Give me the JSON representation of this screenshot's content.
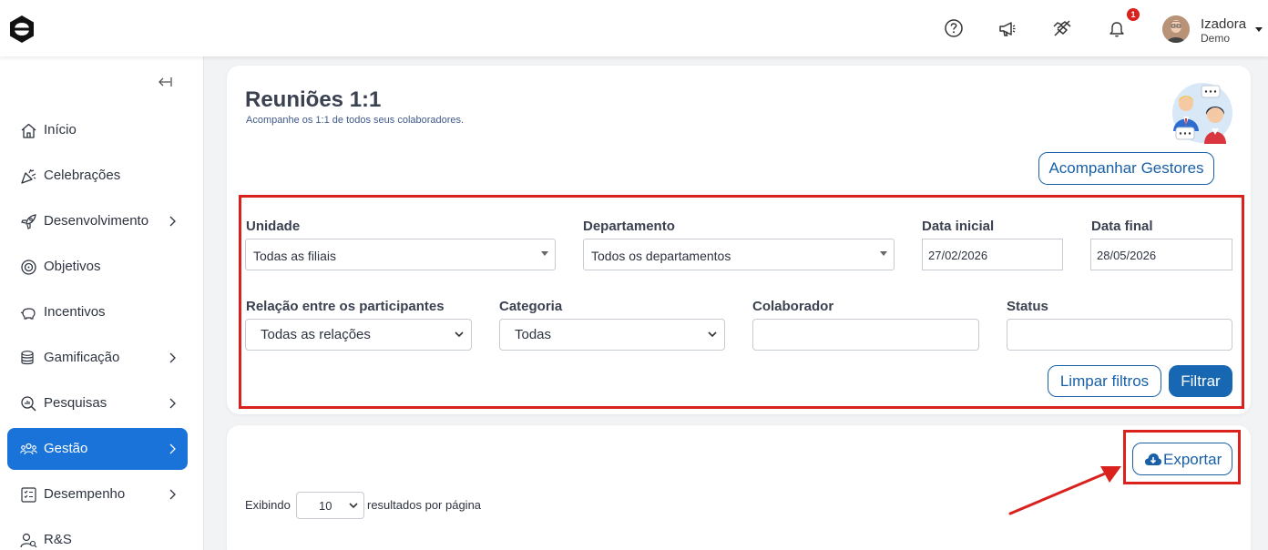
{
  "header": {
    "user_name": "Izadora",
    "user_role": "Demo",
    "notification_count": "1"
  },
  "sidebar": {
    "items": [
      {
        "label": "Início"
      },
      {
        "label": "Celebrações"
      },
      {
        "label": "Desenvolvimento"
      },
      {
        "label": "Objetivos"
      },
      {
        "label": "Incentivos"
      },
      {
        "label": "Gamificação"
      },
      {
        "label": "Pesquisas"
      },
      {
        "label": "Gestão"
      },
      {
        "label": "Desempenho"
      },
      {
        "label": "R&S"
      }
    ]
  },
  "page": {
    "title": "Reuniões 1:1",
    "subtitle": "Acompanhe os 1:1 de todos seus colaboradores.",
    "track_managers_label": "Acompanhar Gestores"
  },
  "filters": {
    "unidade_label": "Unidade",
    "unidade_value": "Todas as filiais",
    "departamento_label": "Departamento",
    "departamento_value": "Todos os departamentos",
    "data_inicial_label": "Data inicial",
    "data_inicial_value": "27/02/2026",
    "data_final_label": "Data final",
    "data_final_value": "28/05/2026",
    "relacao_label": "Relação entre os participantes",
    "relacao_value": "Todas as relações",
    "categoria_label": "Categoria",
    "categoria_value": "Todas",
    "colaborador_label": "Colaborador",
    "colaborador_value": "",
    "status_label": "Status",
    "status_value": "",
    "clear_label": "Limpar filtros",
    "filter_label": "Filtrar"
  },
  "results": {
    "export_label": "Exportar",
    "showing_label": "Exibindo",
    "per_page_value": "10",
    "per_page_suffix": "resultados por página"
  },
  "colors": {
    "accent": "#1767b2",
    "active_nav": "#1a73d9",
    "highlight_red": "#d9211e"
  }
}
